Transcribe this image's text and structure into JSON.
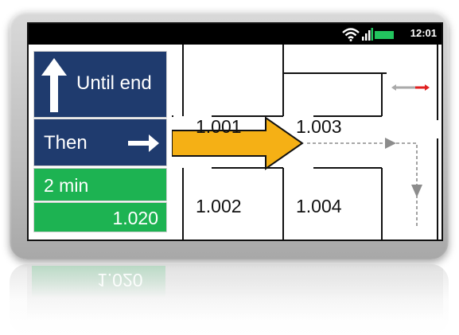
{
  "status_bar": {
    "time": "12:01"
  },
  "nav": {
    "instruction": "Until end",
    "then_label": "Then",
    "duration": "2 min",
    "destination": "1.020"
  },
  "map": {
    "rooms": [
      "1.001",
      "1.003",
      "1.002",
      "1.004"
    ]
  },
  "colors": {
    "nav_blue": "#1f3b6e",
    "nav_green": "#1db352",
    "route_arrow": "#f5b015",
    "battery": "#22c55e"
  },
  "icons": [
    "wifi-icon",
    "signal-icon",
    "battery-icon",
    "up-arrow-icon",
    "right-arrow-icon",
    "route-arrow-icon"
  ]
}
